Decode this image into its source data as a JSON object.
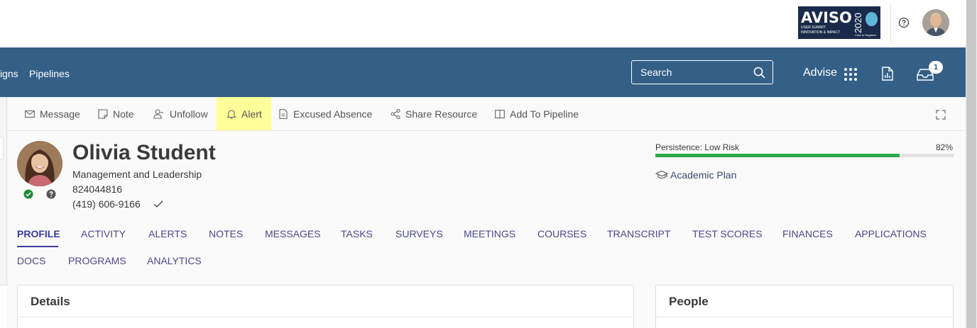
{
  "banner": {
    "word": "AVISO",
    "subtitle": "USER SUMMIT",
    "tagline": "INNOVATION & IMPACT",
    "year": "2020",
    "small_text": "Click to Register!"
  },
  "nav": {
    "links": [
      "igns",
      "Pipelines"
    ],
    "search_placeholder": "Search",
    "advise_label": "Advise",
    "inbox_count": "1"
  },
  "toolbar": {
    "message": "Message",
    "note": "Note",
    "unfollow": "Unfollow",
    "alert": "Alert",
    "excused_absence": "Excused Absence",
    "share_resource": "Share Resource",
    "add_to_pipeline": "Add To Pipeline"
  },
  "student": {
    "name": "Olivia Student",
    "program": "Management and Leadership",
    "id": "824044816",
    "phone": "(419) 606-9166"
  },
  "persistence": {
    "label": "Persistence: Low Risk",
    "percent_label": "82%",
    "value": 0.82,
    "color": "#2eaa4a"
  },
  "academic_plan": "Academic Plan",
  "tabs_row1": [
    "PROFILE",
    "ACTIVITY",
    "ALERTS",
    "NOTES",
    "MESSAGES",
    "TASKS",
    "SURVEYS",
    "MEETINGS",
    "COURSES",
    "TRANSCRIPT",
    "TEST SCORES",
    "FINANCES",
    "APPLICATIONS"
  ],
  "tabs_row2": [
    "DOCS",
    "PROGRAMS",
    "ANALYTICS"
  ],
  "cards": {
    "details": "Details",
    "people": "People"
  },
  "colors": {
    "nav_blue": "#345f87",
    "alert_highlight": "#ffff99",
    "tab_active": "#3b3b9a"
  }
}
